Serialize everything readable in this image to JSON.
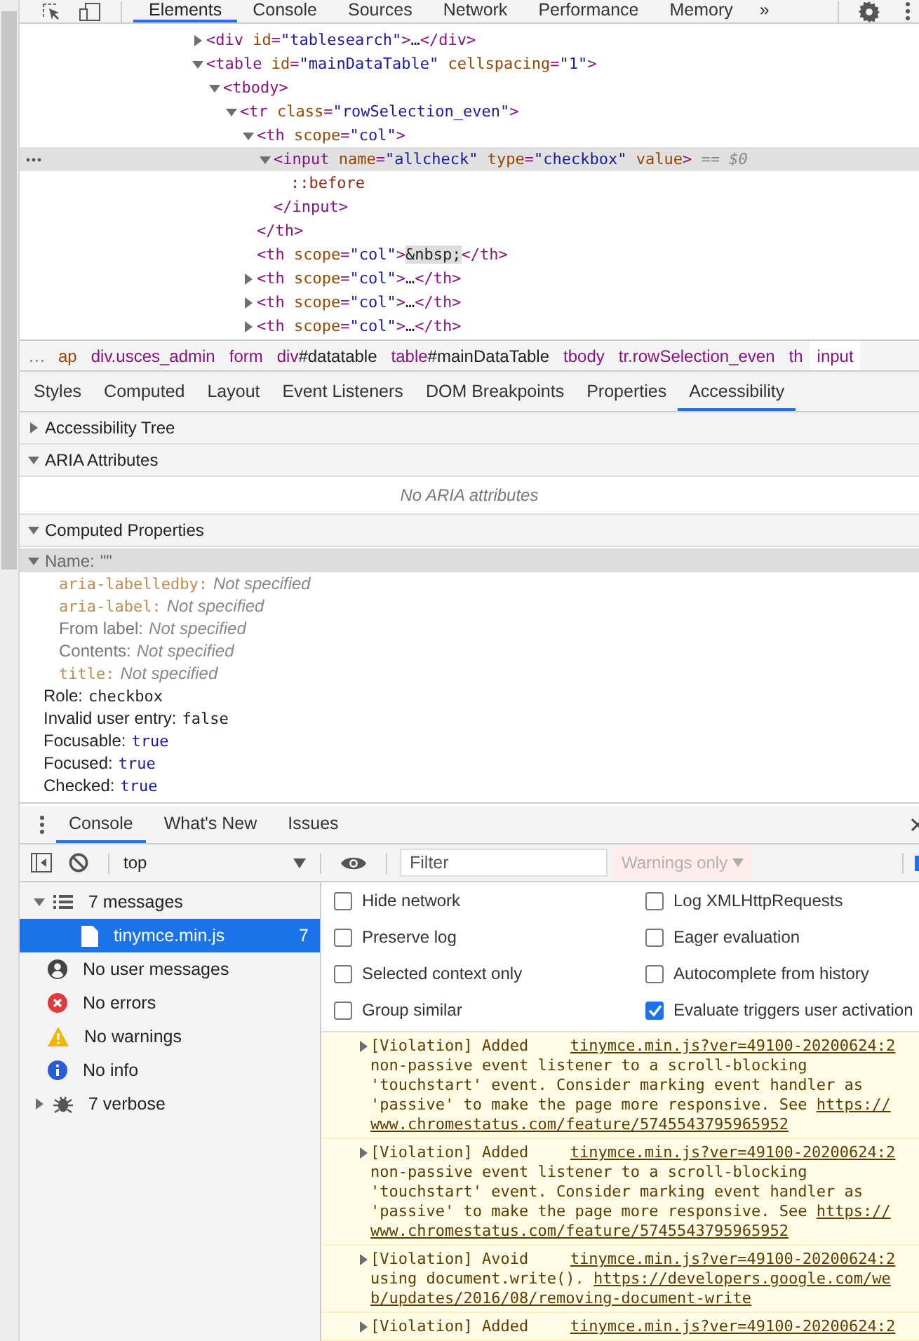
{
  "main_tabs": [
    {
      "label": "Elements",
      "selected": true
    },
    {
      "label": "Console",
      "selected": false
    },
    {
      "label": "Sources",
      "selected": false
    },
    {
      "label": "Network",
      "selected": false
    },
    {
      "label": "Performance",
      "selected": false
    },
    {
      "label": "Memory",
      "selected": false
    }
  ],
  "more_tabs": "»",
  "dom_tree": [
    {
      "expanded": false,
      "selected": false,
      "open": [
        {
          "kind": "tag",
          "text": "<div"
        },
        {
          "kind": "attr",
          "text": " id"
        },
        {
          "kind": "tag",
          "text": "="
        },
        {
          "kind": "value",
          "text": "\"tablesearch\""
        },
        {
          "kind": "tag",
          "text": ">"
        },
        {
          "kind": "text",
          "text": "…"
        },
        {
          "kind": "tag",
          "text": "</div>"
        }
      ]
    },
    {
      "expanded": true,
      "selected": false,
      "open": [
        {
          "kind": "tag",
          "text": "<table"
        },
        {
          "kind": "attr",
          "text": " id"
        },
        {
          "kind": "tag",
          "text": "="
        },
        {
          "kind": "value",
          "text": "\"mainDataTable\""
        },
        {
          "kind": "attr",
          "text": " cellspacing"
        },
        {
          "kind": "tag",
          "text": "="
        },
        {
          "kind": "value",
          "text": "\"1\""
        },
        {
          "kind": "tag",
          "text": ">"
        }
      ],
      "children": [
        {
          "expanded": true,
          "selected": false,
          "open": [
            {
              "kind": "tag",
              "text": "<tbody>"
            }
          ],
          "children": [
            {
              "expanded": true,
              "selected": false,
              "open": [
                {
                  "kind": "tag",
                  "text": "<tr"
                },
                {
                  "kind": "attr",
                  "text": " class"
                },
                {
                  "kind": "tag",
                  "text": "="
                },
                {
                  "kind": "value",
                  "text": "\"rowSelection_even\""
                },
                {
                  "kind": "tag",
                  "text": ">"
                }
              ],
              "children": [
                {
                  "expanded": true,
                  "selected": false,
                  "open": [
                    {
                      "kind": "tag",
                      "text": "<th"
                    },
                    {
                      "kind": "attr",
                      "text": " scope"
                    },
                    {
                      "kind": "tag",
                      "text": "="
                    },
                    {
                      "kind": "value",
                      "text": "\"col\""
                    },
                    {
                      "kind": "tag",
                      "text": ">"
                    }
                  ],
                  "children": [
                    {
                      "expanded": true,
                      "selected": true,
                      "open": [
                        {
                          "kind": "tag",
                          "text": "<input"
                        },
                        {
                          "kind": "attr",
                          "text": " name"
                        },
                        {
                          "kind": "tag",
                          "text": "="
                        },
                        {
                          "kind": "value",
                          "text": "\"allcheck\""
                        },
                        {
                          "kind": "attr",
                          "text": " type"
                        },
                        {
                          "kind": "tag",
                          "text": "="
                        },
                        {
                          "kind": "value",
                          "text": "\"checkbox\""
                        },
                        {
                          "kind": "attr",
                          "text": " value"
                        },
                        {
                          "kind": "tag",
                          "text": ">"
                        },
                        {
                          "kind": "hint",
                          "text": " == $0"
                        }
                      ],
                      "children": [
                        {
                          "selected": false,
                          "open": [
                            {
                              "kind": "pseudo",
                              "text": "::before"
                            }
                          ]
                        }
                      ],
                      "close": [
                        {
                          "kind": "tag",
                          "text": "</input>"
                        }
                      ]
                    }
                  ],
                  "close": [
                    {
                      "kind": "tag",
                      "text": "</th>"
                    }
                  ]
                },
                {
                  "selected": false,
                  "open": [
                    {
                      "kind": "tag",
                      "text": "<th"
                    },
                    {
                      "kind": "attr",
                      "text": " scope"
                    },
                    {
                      "kind": "tag",
                      "text": "="
                    },
                    {
                      "kind": "value",
                      "text": "\"col\""
                    },
                    {
                      "kind": "tag",
                      "text": ">"
                    },
                    {
                      "kind": "entity",
                      "text": "&nbsp;"
                    },
                    {
                      "kind": "tag",
                      "text": "</th>"
                    }
                  ]
                },
                {
                  "expanded": false,
                  "selected": false,
                  "open": [
                    {
                      "kind": "tag",
                      "text": "<th"
                    },
                    {
                      "kind": "attr",
                      "text": " scope"
                    },
                    {
                      "kind": "tag",
                      "text": "="
                    },
                    {
                      "kind": "value",
                      "text": "\"col\""
                    },
                    {
                      "kind": "tag",
                      "text": ">"
                    },
                    {
                      "kind": "text",
                      "text": "…"
                    },
                    {
                      "kind": "tag",
                      "text": "</th>"
                    }
                  ]
                },
                {
                  "expanded": false,
                  "selected": false,
                  "open": [
                    {
                      "kind": "tag",
                      "text": "<th"
                    },
                    {
                      "kind": "attr",
                      "text": " scope"
                    },
                    {
                      "kind": "tag",
                      "text": "="
                    },
                    {
                      "kind": "value",
                      "text": "\"col\""
                    },
                    {
                      "kind": "tag",
                      "text": ">"
                    },
                    {
                      "kind": "text",
                      "text": "…"
                    },
                    {
                      "kind": "tag",
                      "text": "</th>"
                    }
                  ]
                },
                {
                  "expanded": false,
                  "selected": false,
                  "open": [
                    {
                      "kind": "tag",
                      "text": "<th"
                    },
                    {
                      "kind": "attr",
                      "text": " scope"
                    },
                    {
                      "kind": "tag",
                      "text": "="
                    },
                    {
                      "kind": "value",
                      "text": "\"col\""
                    },
                    {
                      "kind": "tag",
                      "text": ">"
                    },
                    {
                      "kind": "text",
                      "text": "…"
                    },
                    {
                      "kind": "tag",
                      "text": "</th>"
                    }
                  ]
                }
              ]
            }
          ]
        }
      ]
    }
  ],
  "breadcrumb": {
    "overflow": "…",
    "items": [
      {
        "selected": false,
        "parts": [
          {
            "kind": "cut",
            "text": "ap"
          }
        ]
      },
      {
        "selected": false,
        "parts": [
          {
            "kind": "tag",
            "text": "div.usces_admin"
          }
        ]
      },
      {
        "selected": false,
        "parts": [
          {
            "kind": "tag",
            "text": "form"
          }
        ]
      },
      {
        "selected": false,
        "parts": [
          {
            "kind": "tag",
            "text": "div"
          },
          {
            "kind": "id",
            "text": "#datatable"
          }
        ]
      },
      {
        "selected": false,
        "parts": [
          {
            "kind": "tag",
            "text": "table"
          },
          {
            "kind": "id",
            "text": "#mainDataTable"
          }
        ]
      },
      {
        "selected": false,
        "parts": [
          {
            "kind": "tag",
            "text": "tbody"
          }
        ]
      },
      {
        "selected": false,
        "parts": [
          {
            "kind": "tag",
            "text": "tr.rowSelection_even"
          }
        ]
      },
      {
        "selected": false,
        "parts": [
          {
            "kind": "tag",
            "text": "th"
          }
        ]
      },
      {
        "selected": true,
        "parts": [
          {
            "kind": "tag",
            "text": "input"
          }
        ]
      }
    ]
  },
  "panel_tabs": [
    {
      "label": "Styles",
      "selected": false
    },
    {
      "label": "Computed",
      "selected": false
    },
    {
      "label": "Layout",
      "selected": false
    },
    {
      "label": "Event Listeners",
      "selected": false
    },
    {
      "label": "DOM Breakpoints",
      "selected": false
    },
    {
      "label": "Properties",
      "selected": false
    },
    {
      "label": "Accessibility",
      "selected": true
    }
  ],
  "accessibility": [
    {
      "kind": "tree",
      "title": "Accessibility Tree",
      "expanded": false
    },
    {
      "kind": "aria",
      "title": "ARIA Attributes",
      "expanded": true,
      "empty_message": "No ARIA attributes"
    },
    {
      "kind": "computed",
      "title": "Computed Properties",
      "expanded": true,
      "name": {
        "label": "Name:",
        "value": "\"\"",
        "expanded": true,
        "selected": true,
        "sources": [
          {
            "kind": "attribute",
            "label": "aria-labelledby:",
            "value": "Not specified"
          },
          {
            "kind": "attribute",
            "label": "aria-label:",
            "value": "Not specified"
          },
          {
            "kind": "text",
            "label": "From label:",
            "value": "Not specified"
          },
          {
            "kind": "text",
            "label": "Contents:",
            "value": "Not specified"
          },
          {
            "kind": "attribute",
            "label": "title:",
            "value": "Not specified"
          }
        ]
      },
      "properties": [
        {
          "kind": "token",
          "label": "Role:",
          "value": "checkbox"
        },
        {
          "kind": "token",
          "label": "Invalid user entry:",
          "value": "false"
        },
        {
          "kind": "boolean",
          "label": "Focusable:",
          "value": "true"
        },
        {
          "kind": "boolean",
          "label": "Focused:",
          "value": "true"
        },
        {
          "kind": "boolean",
          "label": "Checked:",
          "value": "true"
        }
      ]
    }
  ],
  "drawer": {
    "tabs": [
      {
        "label": "Console",
        "selected": true
      },
      {
        "label": "What's New",
        "selected": false
      },
      {
        "label": "Issues",
        "selected": false
      }
    ],
    "context": "top",
    "filter_placeholder": "Filter",
    "levels": "Warnings only",
    "levels_disabled": true,
    "sidebar": [
      {
        "kind": "group",
        "label": "7 messages",
        "expanded": true,
        "selected": false,
        "children": [
          {
            "kind": "file",
            "label": "tinymce.min.js",
            "count": "7",
            "selected": true
          }
        ]
      },
      {
        "kind": "user",
        "label": "No user messages",
        "selected": false
      },
      {
        "kind": "error",
        "label": "No errors",
        "selected": false
      },
      {
        "kind": "warning",
        "label": "No warnings",
        "selected": false
      },
      {
        "kind": "info",
        "label": "No info",
        "selected": false
      },
      {
        "kind": "verbose",
        "label": "7 verbose",
        "expanded": false,
        "selected": false
      }
    ],
    "settings": [
      {
        "label": "Hide network",
        "checked": false
      },
      {
        "label": "Log XMLHttpRequests",
        "checked": false
      },
      {
        "label": "Preserve log",
        "checked": false
      },
      {
        "label": "Eager evaluation",
        "checked": false
      },
      {
        "label": "Selected context only",
        "checked": false
      },
      {
        "label": "Autocomplete from history",
        "checked": false
      },
      {
        "label": "Group similar",
        "checked": false
      },
      {
        "label": "Evaluate triggers user activation",
        "checked": true
      }
    ],
    "messages": [
      {
        "expanded": false,
        "source": "tinymce.min.js?ver=49100-20200624:2",
        "head": "[Violation] Added",
        "text": "non-passive event listener to a scroll-blocking 'touchstart' event. Consider marking event handler as 'passive' to make the page more responsive. See",
        "link": "https://www.chromestatus.com/feature/5745543795965952"
      },
      {
        "expanded": false,
        "source": "tinymce.min.js?ver=49100-20200624:2",
        "head": "[Violation] Added",
        "text": "non-passive event listener to a scroll-blocking 'touchstart' event. Consider marking event handler as 'passive' to make the page more responsive. See",
        "link": "https://www.chromestatus.com/feature/5745543795965952"
      },
      {
        "expanded": false,
        "source": "tinymce.min.js?ver=49100-20200624:2",
        "head": "[Violation] Avoid",
        "text": "using document.write().",
        "link": "https://developers.google.com/web/updates/2016/08/removing-document-write"
      },
      {
        "expanded": false,
        "source": "tinymce.min.js?ver=49100-20200624:2",
        "head": "[Violation] Added"
      }
    ]
  }
}
